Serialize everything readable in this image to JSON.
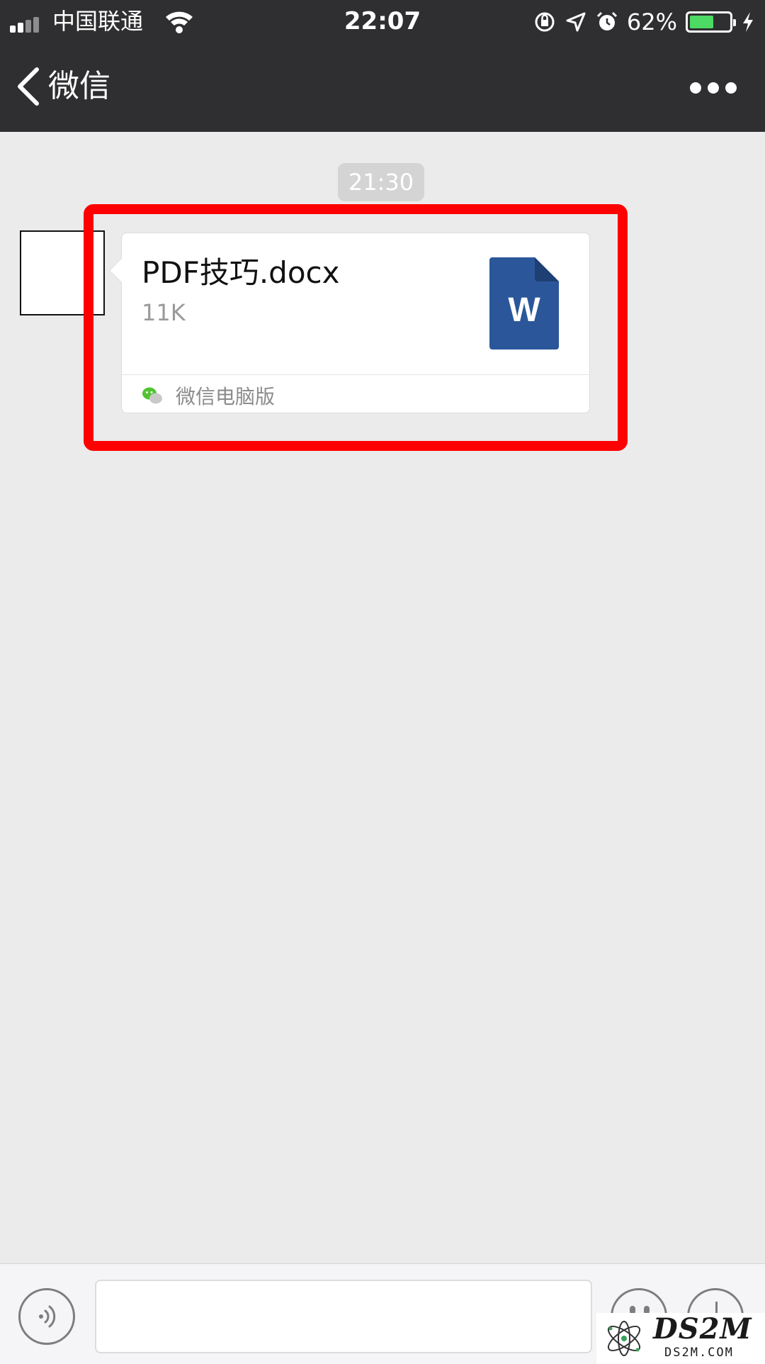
{
  "status_bar": {
    "carrier": "中国联通",
    "time": "22:07",
    "battery_percent_label": "62%",
    "battery_level": 0.62,
    "icons": [
      "signal-icon",
      "wifi-icon",
      "orientation-lock-icon",
      "location-icon",
      "alarm-icon",
      "battery-icon",
      "charging-icon"
    ]
  },
  "nav": {
    "back_label": "微信",
    "back_icon": "chevron-left-icon",
    "more_icon": "more-dots-icon"
  },
  "chat": {
    "timestamp": "21:30",
    "file_message": {
      "file_name": "PDF技巧.docx",
      "file_size": "11K",
      "file_icon": "word-doc-icon",
      "icon_letter": "W",
      "source": "微信电脑版",
      "source_icon": "wechat-icon"
    },
    "highlight_color": "#ff0000"
  },
  "input_bar": {
    "voice_icon": "voice-icon",
    "emoji_icon": "emoji-icon",
    "plus_icon": "plus-icon"
  },
  "watermark": {
    "brand": "DS2M",
    "url": "DS2M.COM"
  },
  "colors": {
    "nav_bg": "#2f2f31",
    "chat_bg": "#ebebeb",
    "word_blue": "#2b579a",
    "battery_green": "#4cd964"
  }
}
